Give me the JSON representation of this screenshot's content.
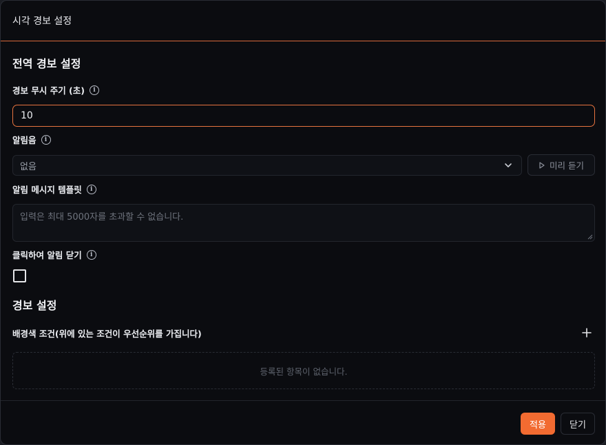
{
  "dialog": {
    "title": "시각 경보 설정"
  },
  "global_section": {
    "title": "전역 경보 설정",
    "ignore_period": {
      "label": "경보 무시 주기 (초)",
      "value": "10"
    },
    "sound": {
      "label": "알림음",
      "selected": "없음",
      "preview_label": "미리 듣기"
    },
    "message_template": {
      "label": "알림 메시지 템플릿",
      "placeholder": "입력은 최대 5000자를 초과할 수 없습니다."
    },
    "click_to_close": {
      "label": "클릭하여 알림 닫기",
      "checked": false
    }
  },
  "alert_section": {
    "title": "경보 설정",
    "bg_condition": {
      "label": "배경색 조건(위에 있는 조건이 우선순위를 가집니다)",
      "empty_text": "등록된 항목이 없습니다."
    }
  },
  "footer": {
    "apply_label": "적용",
    "close_label": "닫기"
  },
  "colors": {
    "accent": "#f26b31",
    "background": "#0b0c10",
    "border": "#23262d"
  },
  "icons": [
    "info-icon",
    "chevron-down-icon",
    "play-icon",
    "plus-icon",
    "resize-grip-icon"
  ]
}
